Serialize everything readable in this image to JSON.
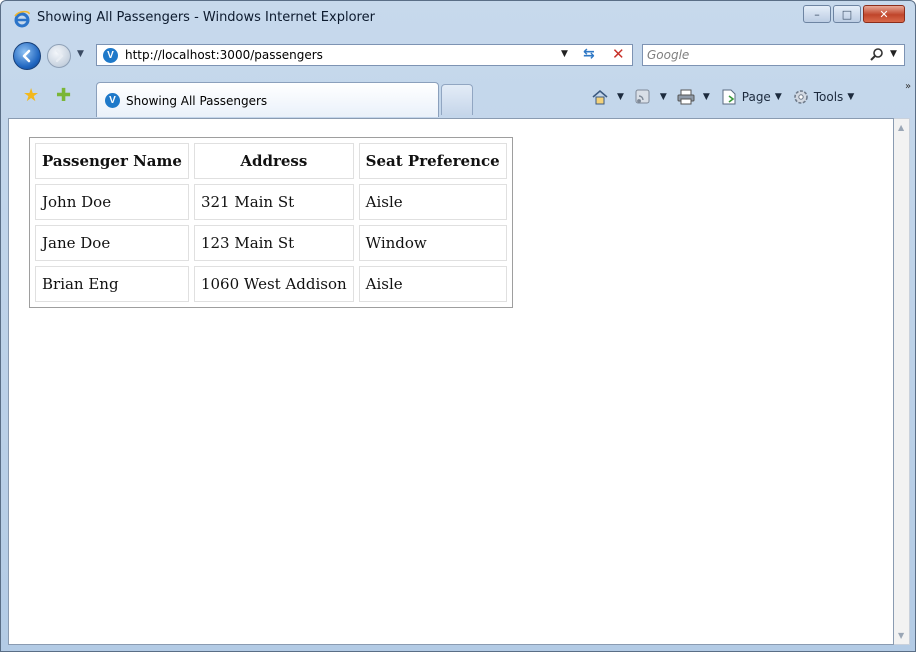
{
  "window": {
    "title": "Showing All Passengers - Windows Internet Explorer",
    "controls": {
      "minimize": "–",
      "maximize": "□",
      "close": "✕"
    }
  },
  "address_bar": {
    "site_icon": "V",
    "url": "http://localhost:3000/passengers"
  },
  "search": {
    "placeholder": "Google"
  },
  "tab": {
    "icon": "V",
    "label": "Showing All Passengers"
  },
  "command_bar": {
    "page_label": "Page",
    "tools_label": "Tools",
    "more": "»"
  },
  "table": {
    "headers": [
      "Passenger Name",
      "Address",
      "Seat Preference"
    ],
    "rows": [
      [
        "John Doe",
        "321 Main St",
        "Aisle"
      ],
      [
        "Jane Doe",
        "123 Main St",
        "Window"
      ],
      [
        "Brian Eng",
        "1060 West Addison",
        "Aisle"
      ]
    ]
  },
  "icons": {
    "title": "ie-logo-icon",
    "back": "back-arrow-icon",
    "forward": "forward-arrow-icon",
    "refresh": "refresh-icon",
    "stop": "stop-icon",
    "search": "magnifier-icon",
    "favorites": "favorites-star-icon",
    "add_favorites": "add-favorites-icon",
    "home": "home-icon",
    "feeds": "feeds-icon",
    "print": "print-icon",
    "page": "page-icon",
    "tools": "tools-gear-icon"
  },
  "colors": {
    "chrome": "#b3cbe5",
    "close_button": "#c0452b",
    "link_blue": "#1f79c9"
  }
}
